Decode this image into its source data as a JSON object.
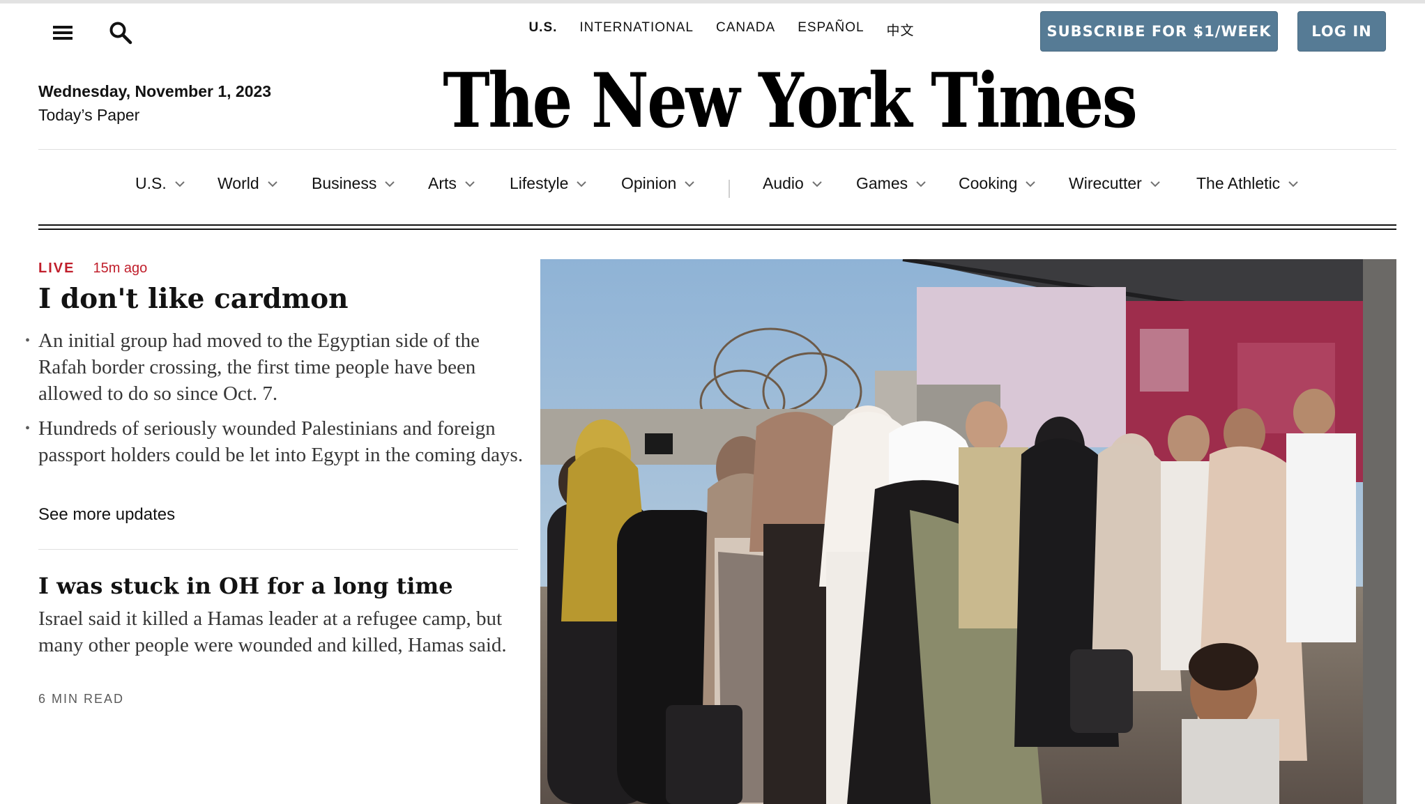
{
  "header": {
    "editions": [
      {
        "label": "U.S."
      },
      {
        "label": "INTERNATIONAL"
      },
      {
        "label": "CANADA"
      },
      {
        "label": "ESPAÑOL"
      },
      {
        "label": "中文"
      }
    ],
    "subscribe_label": "SUBSCRIBE FOR $1/WEEK",
    "login_label": "LOG IN",
    "date": "Wednesday, November 1, 2023",
    "todays_paper": "Today’s Paper",
    "masthead": "The New York Times",
    "icons": {
      "menu": "hamburger-menu-icon",
      "search": "search-icon"
    },
    "button_color": "#567b95"
  },
  "nav": {
    "items": [
      {
        "label": "U.S."
      },
      {
        "label": "World"
      },
      {
        "label": "Business"
      },
      {
        "label": "Arts"
      },
      {
        "label": "Lifestyle"
      },
      {
        "label": "Opinion"
      },
      {
        "label": "Audio"
      },
      {
        "label": "Games"
      },
      {
        "label": "Cooking"
      },
      {
        "label": "Wirecutter"
      },
      {
        "label": "The Athletic"
      }
    ]
  },
  "story1": {
    "live_label": "LIVE",
    "time_ago": "15m ago",
    "headline": "I don't like cardmon",
    "bullets": [
      "An initial group had moved to the Egyptian side of the Rafah border crossing, the first time people have been allowed to do so since Oct. 7.",
      "Hundreds of seriously wounded Palestinians and foreign passport holders could be let into Egypt in the coming days."
    ],
    "see_more": "See more updates",
    "live_color": "#c01e2b"
  },
  "story2": {
    "headline": "I was stuck in OH for a long time",
    "summary": "Israel said it killed a Hamas leader at a refugee camp, but many other people were wounded and killed, Hamas said.",
    "read_time": "6 MIN READ"
  }
}
